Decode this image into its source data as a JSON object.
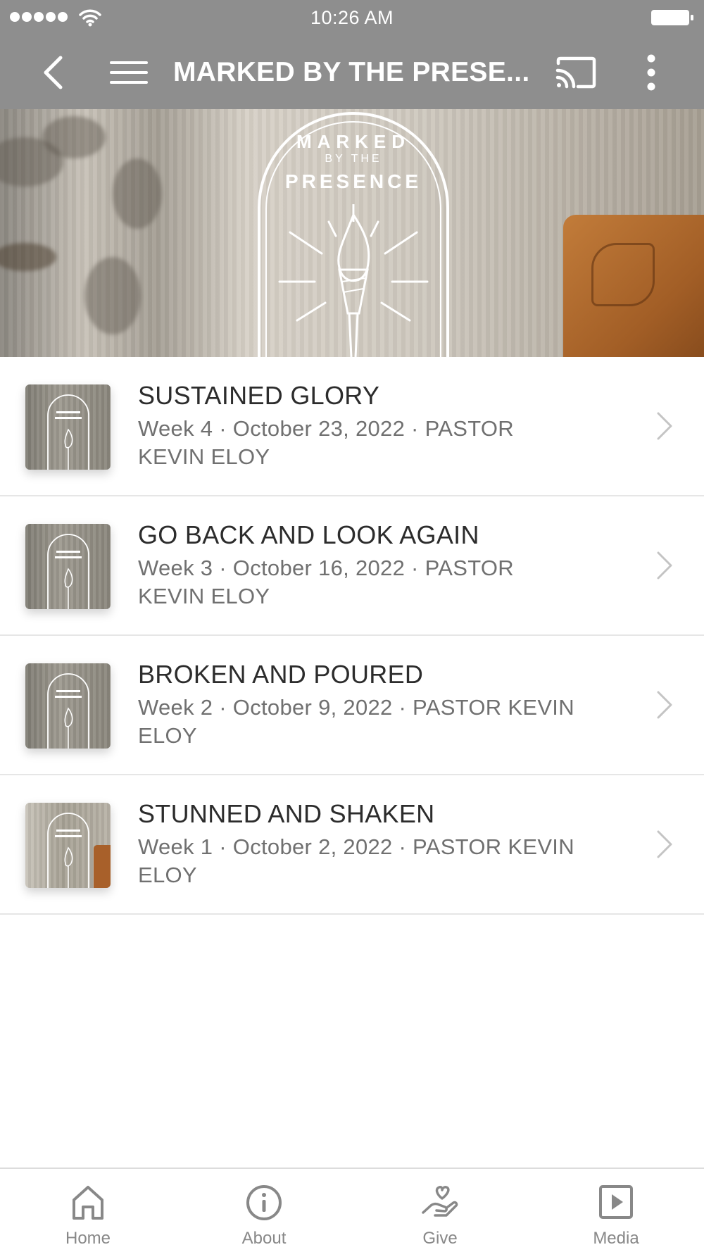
{
  "status_bar": {
    "time": "10:26 AM"
  },
  "nav": {
    "title": "MARKED BY THE PRESE..."
  },
  "banner": {
    "logo_text": [
      "MARKED",
      "BY THE",
      "PRESENCE"
    ]
  },
  "sermons": [
    {
      "title": "SUSTAINED GLORY",
      "meta": "Week 4 · October 23, 2022 · PASTOR KEVIN ELOY"
    },
    {
      "title": "GO BACK AND LOOK AGAIN",
      "meta": "Week 3 · October 16, 2022 · PASTOR KEVIN ELOY"
    },
    {
      "title": "BROKEN AND POURED",
      "meta": "Week 2 · October 9, 2022 · PASTOR KEVIN ELOY"
    },
    {
      "title": "STUNNED AND SHAKEN",
      "meta": "Week 1 · October 2, 2022 · PASTOR KEVIN ELOY"
    }
  ],
  "tabs": [
    {
      "label": "Home",
      "icon": "home-icon"
    },
    {
      "label": "About",
      "icon": "info-icon"
    },
    {
      "label": "Give",
      "icon": "give-icon"
    },
    {
      "label": "Media",
      "icon": "media-icon"
    }
  ],
  "colors": {
    "header": "#8e8e8e",
    "tab": "#888888",
    "title": "#2c2c2c",
    "meta": "#707070"
  }
}
